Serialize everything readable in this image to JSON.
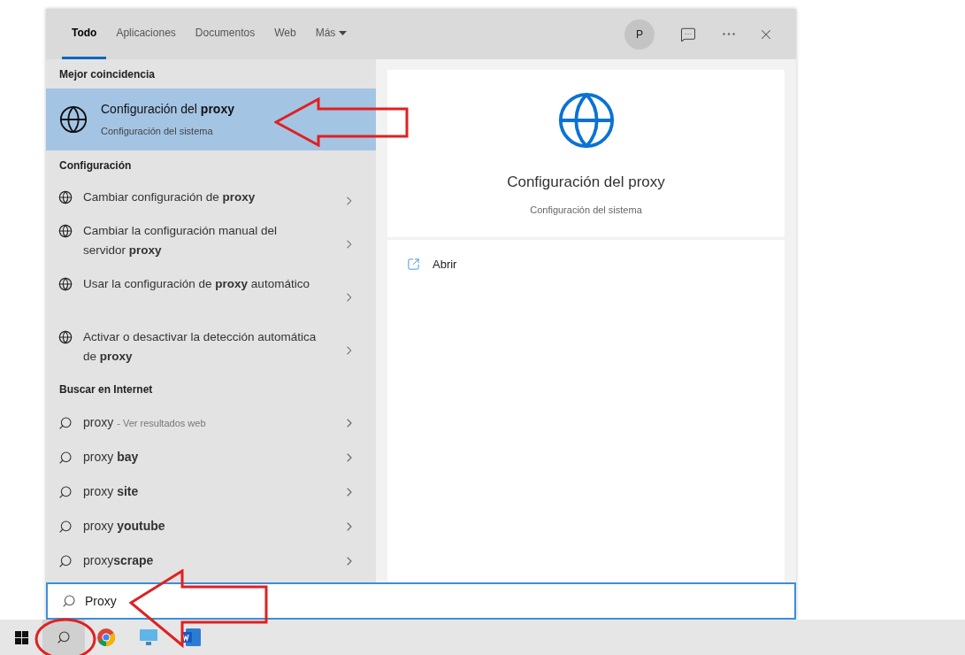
{
  "tabs": [
    {
      "label": "Todo",
      "selected": true
    },
    {
      "label": "Aplicaciones",
      "selected": false
    },
    {
      "label": "Documentos",
      "selected": false
    },
    {
      "label": "Web",
      "selected": false
    },
    {
      "label": "Más",
      "selected": false,
      "kind": "menu"
    }
  ],
  "account": {
    "initial": "P"
  },
  "best_match": {
    "heading": "Mejor coincidencia",
    "title": "Configuración del **proxy**",
    "subtitle": "Configuración del sistema",
    "selected": true
  },
  "settings": {
    "heading": "Configuración",
    "items": [
      {
        "text": "Cambiar configuración de **proxy**"
      },
      {
        "text": "Cambiar la configuración manual del servidor **proxy**"
      },
      {
        "text": "Usar la configuración de **proxy** automático"
      },
      {
        "text": "Activar o desactivar la detección automática de **proxy**"
      }
    ]
  },
  "web": {
    "heading": "Buscar en Internet",
    "items": [
      {
        "text": "proxy",
        "hint": "- Ver resultados web"
      },
      {
        "text": "proxy **bay**"
      },
      {
        "text": "proxy **site**"
      },
      {
        "text": "proxy **youtube**"
      },
      {
        "text": "proxy**scrape**"
      }
    ]
  },
  "preview": {
    "title": "Configuración del proxy",
    "subtitle": "Configuración del sistema",
    "actions": [
      {
        "label": "Abrir"
      }
    ]
  },
  "search": {
    "value": "Proxy"
  }
}
